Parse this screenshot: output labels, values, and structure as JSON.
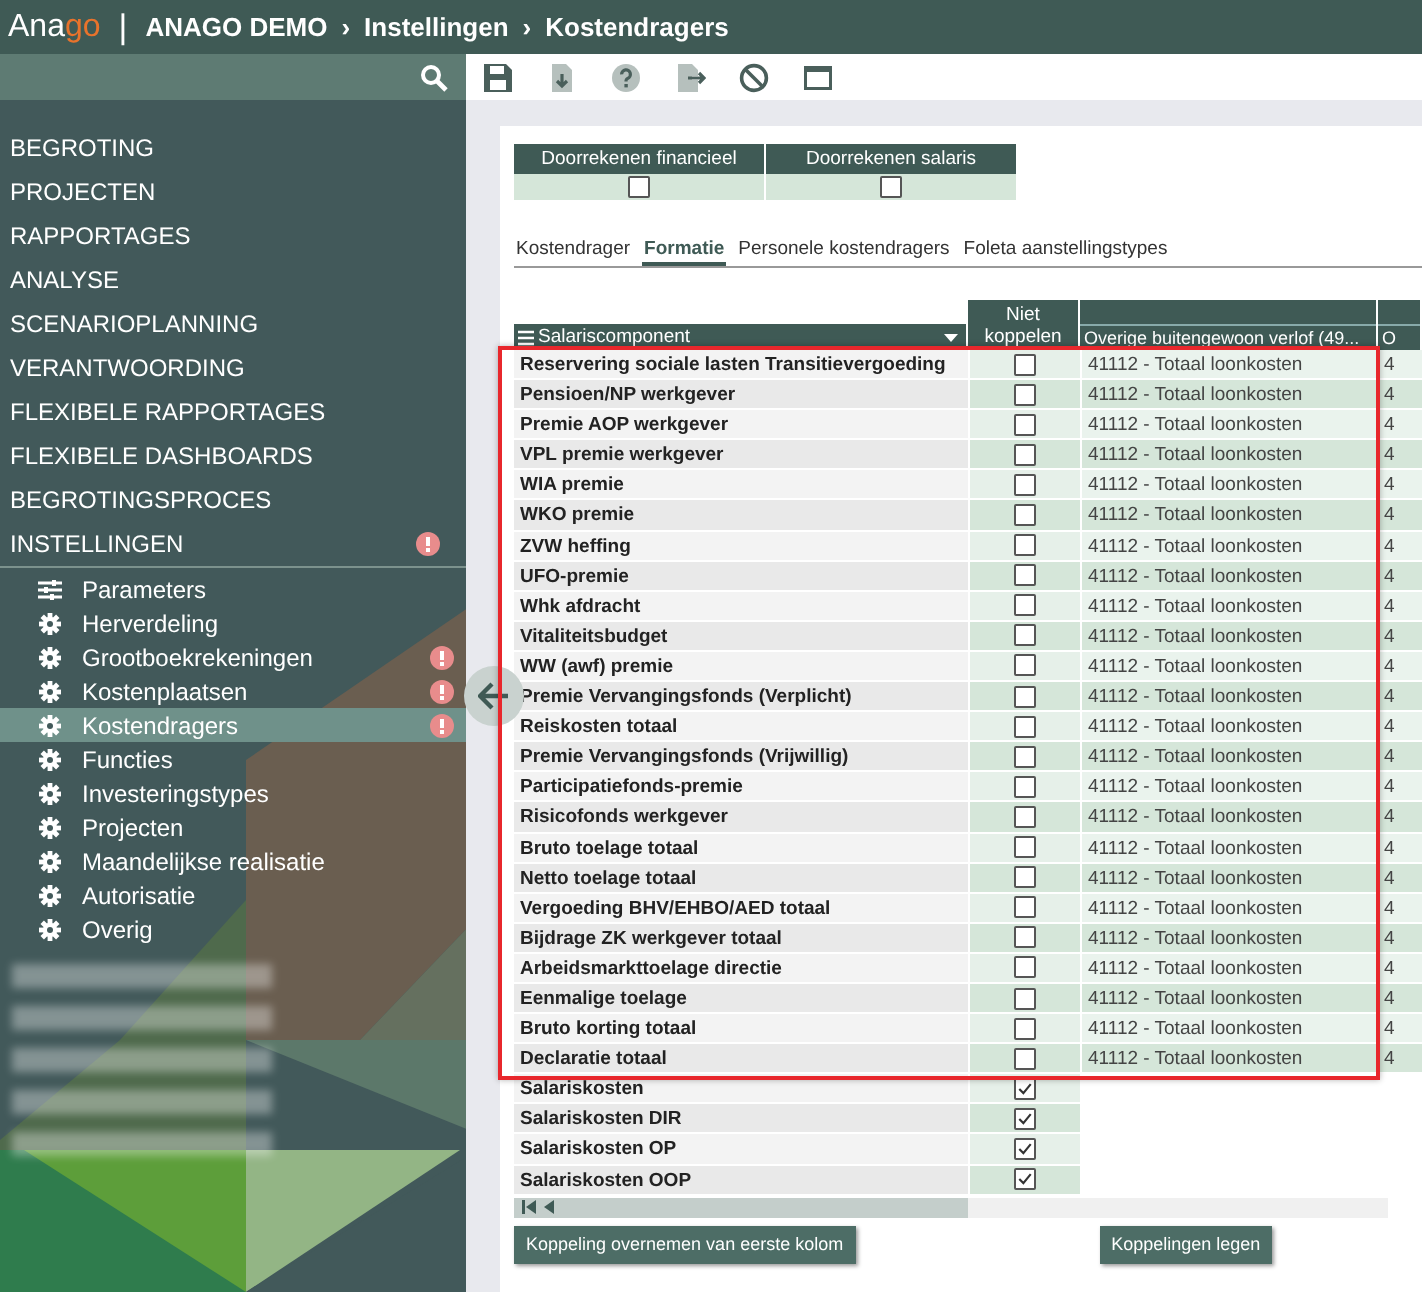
{
  "header": {
    "logo": {
      "main": "Ana",
      "accent": "go"
    },
    "divider": "|",
    "breadcrumb": [
      {
        "label": "ANAGO DEMO"
      },
      {
        "label": "Instellingen"
      },
      {
        "label": "Kostendragers"
      }
    ],
    "separator": "›"
  },
  "toolbar": [
    {
      "kind": "save"
    },
    {
      "kind": "import"
    },
    {
      "kind": "help"
    },
    {
      "kind": "export"
    },
    {
      "kind": "block"
    },
    {
      "kind": "window"
    }
  ],
  "sidebar": {
    "menu": [
      {
        "kind": "section",
        "label": "BEGROTING",
        "alert": false,
        "expanded": false
      },
      {
        "kind": "section",
        "label": "PROJECTEN",
        "alert": false,
        "expanded": false
      },
      {
        "kind": "section",
        "label": "RAPPORTAGES",
        "alert": false,
        "expanded": false
      },
      {
        "kind": "section",
        "label": "ANALYSE",
        "alert": false,
        "expanded": false
      },
      {
        "kind": "section",
        "label": "SCENARIOPLANNING",
        "alert": false,
        "expanded": false
      },
      {
        "kind": "section",
        "label": "VERANTWOORDING",
        "alert": false,
        "expanded": false
      },
      {
        "kind": "section",
        "label": "FLEXIBELE RAPPORTAGES",
        "alert": false,
        "expanded": false
      },
      {
        "kind": "section",
        "label": "FLEXIBELE DASHBOARDS",
        "alert": false,
        "expanded": false
      },
      {
        "kind": "section",
        "label": "BEGROTINGSPROCES",
        "alert": false,
        "expanded": false
      },
      {
        "kind": "section",
        "label": "INSTELLINGEN",
        "alert": true,
        "expanded": true,
        "children": [
          {
            "kind": "sliders",
            "label": "Parameters",
            "alert": false,
            "selected": false
          },
          {
            "kind": "gear",
            "label": "Herverdeling",
            "alert": false,
            "selected": false
          },
          {
            "kind": "gear",
            "label": "Grootboekrekeningen",
            "alert": true,
            "selected": false
          },
          {
            "kind": "gear",
            "label": "Kostenplaatsen",
            "alert": true,
            "selected": false
          },
          {
            "kind": "gear",
            "label": "Kostendragers",
            "alert": true,
            "selected": true
          },
          {
            "kind": "gear",
            "label": "Functies",
            "alert": false,
            "selected": false
          },
          {
            "kind": "gear",
            "label": "Investeringstypes",
            "alert": false,
            "selected": false
          },
          {
            "kind": "gear",
            "label": "Projecten",
            "alert": false,
            "selected": false
          },
          {
            "kind": "gear",
            "label": "Maandelijkse realisatie",
            "alert": false,
            "selected": false
          },
          {
            "kind": "gear",
            "label": "Autorisatie",
            "alert": false,
            "selected": false
          },
          {
            "kind": "gear",
            "label": "Overig",
            "alert": false,
            "selected": false
          }
        ]
      },
      {
        "kind": "blurred"
      },
      {
        "kind": "blurred"
      },
      {
        "kind": "blurred"
      },
      {
        "kind": "blurred"
      },
      {
        "kind": "blurred"
      }
    ]
  },
  "options": [
    {
      "label": "Doorrekenen financieel",
      "checked": false
    },
    {
      "label": "Doorrekenen salaris",
      "checked": false
    }
  ],
  "tabs": [
    {
      "label": "Kostendrager",
      "selected": false
    },
    {
      "label": "Formatie",
      "selected": true
    },
    {
      "label": "Personele kostendragers",
      "selected": false
    },
    {
      "label": "Foleta aanstellingstypes",
      "selected": false
    }
  ],
  "table": {
    "columns": [
      "Salariscomponent",
      "Niet koppelen",
      "Overige buitengewoon verlof (49...",
      "O"
    ],
    "row_groups": [
      {
        "highlighted": true,
        "rows": [
          {
            "name": "Reservering sociale lasten Transitievergoeding",
            "checked": false,
            "column_3": "41112 - Totaal loonkosten",
            "column_4": "4"
          },
          {
            "name": "Pensioen/NP werkgever",
            "checked": false,
            "column_3": "41112 - Totaal loonkosten",
            "column_4": "4"
          },
          {
            "name": "Premie AOP werkgever",
            "checked": false,
            "column_3": "41112 - Totaal loonkosten",
            "column_4": "4"
          },
          {
            "name": "VPL premie werkgever",
            "checked": false,
            "column_3": "41112 - Totaal loonkosten",
            "column_4": "4"
          },
          {
            "name": "WIA premie",
            "checked": false,
            "column_3": "41112 - Totaal loonkosten",
            "column_4": "4"
          },
          {
            "name": "WKO premie",
            "checked": false,
            "column_3": "41112 - Totaal loonkosten",
            "column_4": "4"
          },
          {
            "name": "ZVW heffing",
            "checked": false,
            "column_3": "41112 - Totaal loonkosten",
            "column_4": "4"
          },
          {
            "name": "UFO-premie",
            "checked": false,
            "column_3": "41112 - Totaal loonkosten",
            "column_4": "4"
          },
          {
            "name": "Whk afdracht",
            "checked": false,
            "column_3": "41112 - Totaal loonkosten",
            "column_4": "4"
          },
          {
            "name": "Vitaliteitsbudget",
            "checked": false,
            "column_3": "41112 - Totaal loonkosten",
            "column_4": "4"
          },
          {
            "name": "WW (awf) premie",
            "checked": false,
            "column_3": "41112 - Totaal loonkosten",
            "column_4": "4"
          },
          {
            "name": "Premie Vervangingsfonds (Verplicht)",
            "checked": false,
            "column_3": "41112 - Totaal loonkosten",
            "column_4": "4"
          },
          {
            "name": "Reiskosten totaal",
            "checked": false,
            "column_3": "41112 - Totaal loonkosten",
            "column_4": "4"
          },
          {
            "name": "Premie Vervangingsfonds (Vrijwillig)",
            "checked": false,
            "column_3": "41112 - Totaal loonkosten",
            "column_4": "4"
          },
          {
            "name": "Participatiefonds-premie",
            "checked": false,
            "column_3": "41112 - Totaal loonkosten",
            "column_4": "4"
          },
          {
            "name": "Risicofonds werkgever",
            "checked": false,
            "column_3": "41112 - Totaal loonkosten",
            "column_4": "4"
          },
          {
            "name": "Bruto toelage totaal",
            "checked": false,
            "column_3": "41112 - Totaal loonkosten",
            "column_4": "4"
          },
          {
            "name": "Netto toelage totaal",
            "checked": false,
            "column_3": "41112 - Totaal loonkosten",
            "column_4": "4"
          },
          {
            "name": "Vergoeding BHV/EHBO/AED totaal",
            "checked": false,
            "column_3": "41112 - Totaal loonkosten",
            "column_4": "4"
          },
          {
            "name": "Bijdrage ZK werkgever totaal",
            "checked": false,
            "column_3": "41112 - Totaal loonkosten",
            "column_4": "4"
          },
          {
            "name": "Arbeidsmarkttoelage directie",
            "checked": false,
            "column_3": "41112 - Totaal loonkosten",
            "column_4": "4"
          },
          {
            "name": "Eenmalige toelage",
            "checked": false,
            "column_3": "41112 - Totaal loonkosten",
            "column_4": "4"
          },
          {
            "name": "Bruto korting totaal",
            "checked": false,
            "column_3": "41112 - Totaal loonkosten",
            "column_4": "4"
          },
          {
            "name": "Declaratie totaal",
            "checked": false,
            "column_3": "41112 - Totaal loonkosten",
            "column_4": "4"
          }
        ]
      },
      {
        "highlighted": false,
        "rows": [
          {
            "name": "Salariskosten",
            "checked": true
          },
          {
            "name": "Salariskosten DIR",
            "checked": true
          },
          {
            "name": "Salariskosten OP",
            "checked": true
          },
          {
            "name": "Salariskosten OOP",
            "checked": true
          }
        ]
      }
    ]
  },
  "buttons": [
    {
      "label": "Koppeling overnemen van eerste kolom"
    },
    {
      "label": "Koppelingen legen"
    }
  ]
}
